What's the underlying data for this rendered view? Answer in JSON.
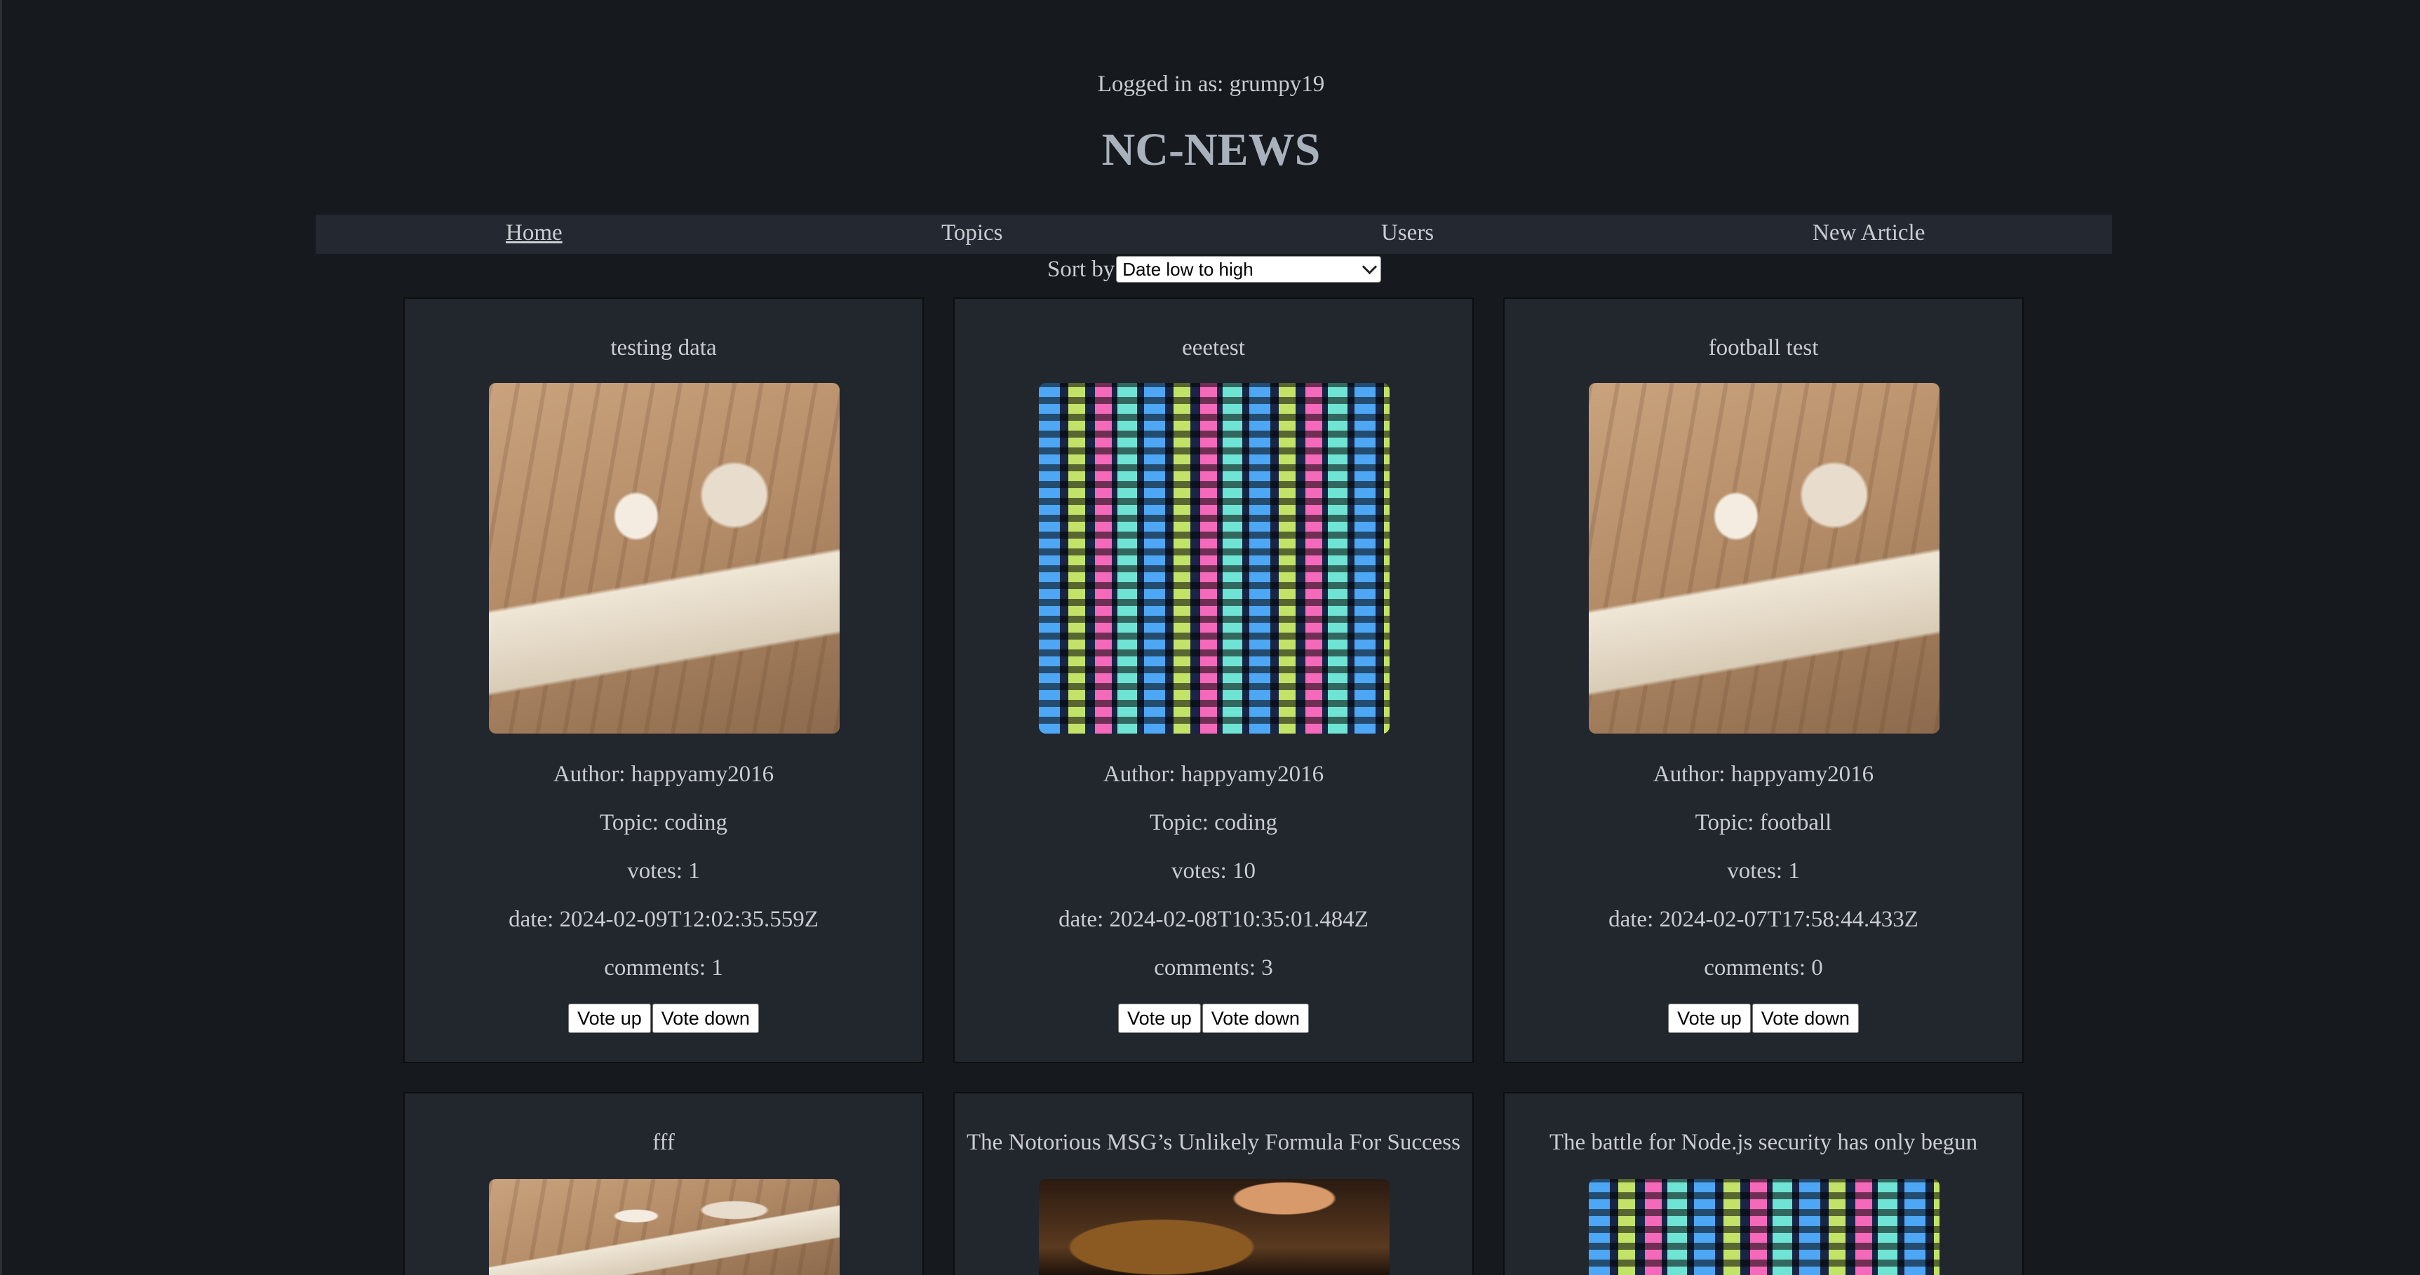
{
  "header": {
    "logged_in_text": "Logged in as: grumpy19",
    "site_title": "NC-NEWS"
  },
  "nav": {
    "items": [
      {
        "label": "Home",
        "active": true
      },
      {
        "label": "Topics",
        "active": false
      },
      {
        "label": "Users",
        "active": false
      },
      {
        "label": "New Article",
        "active": false
      }
    ]
  },
  "sort": {
    "label": "Sort by",
    "selected": "Date low to high"
  },
  "articles": [
    {
      "title": "testing data",
      "image": "coffee-newspaper",
      "author": "Author: happyamy2016",
      "topic": "Topic: coding",
      "votes": "votes: 1",
      "date": "date: 2024-02-09T12:02:35.559Z",
      "comments": "comments: 1"
    },
    {
      "title": "eeetest",
      "image": "code-screen",
      "author": "Author: happyamy2016",
      "topic": "Topic: coding",
      "votes": "votes: 10",
      "date": "date: 2024-02-08T10:35:01.484Z",
      "comments": "comments: 3"
    },
    {
      "title": "football test",
      "image": "coffee-newspaper",
      "author": "Author: happyamy2016",
      "topic": "Topic: football",
      "votes": "votes: 1",
      "date": "date: 2024-02-07T17:58:44.433Z",
      "comments": "comments: 0"
    },
    {
      "title": "fff",
      "image": "coffee-newspaper"
    },
    {
      "title": "The Notorious MSG’s Unlikely Formula For Success",
      "image": "cooking"
    },
    {
      "title": "The battle for Node.js security has only begun",
      "image": "code-screen"
    }
  ],
  "buttons": {
    "vote_up": "Vote up",
    "vote_down": "Vote down"
  }
}
